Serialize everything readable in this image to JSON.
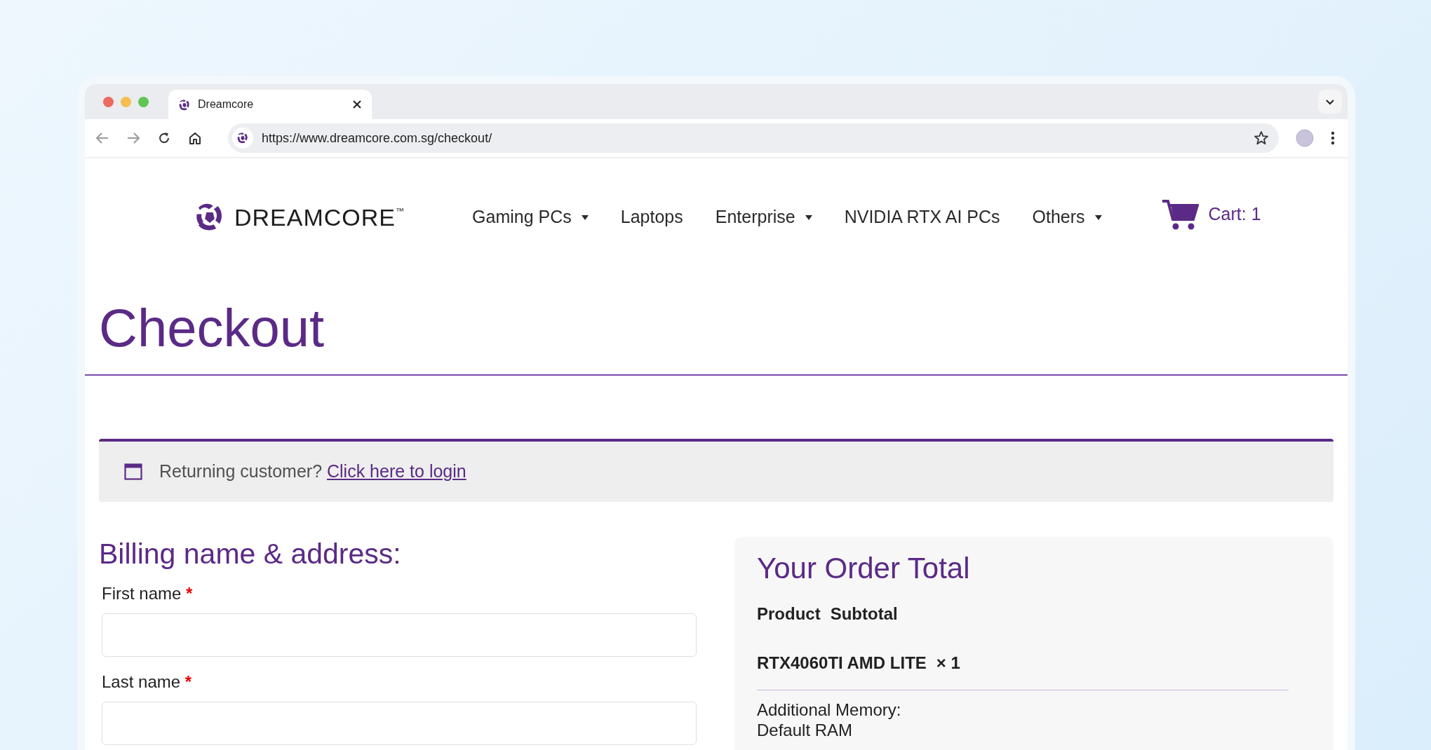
{
  "browser": {
    "tab_title": "Dreamcore",
    "url": "https://www.dreamcore.com.sg/checkout/"
  },
  "nav": {
    "logo_text": "DREAMCORE$^{™}$",
    "items": [
      {
        "label": "Gaming PCs",
        "dropdown": true
      },
      {
        "label": "Laptops",
        "dropdown": false
      },
      {
        "label": "Enterprise",
        "dropdown": true
      },
      {
        "label": "NVIDIA RTX AI PCs",
        "dropdown": false
      },
      {
        "label": "Others",
        "dropdown": true
      }
    ],
    "cart": "Cart: 1"
  },
  "page_title": "Checkout",
  "notice": {
    "text": "Returning customer?",
    "link": "Click here to login"
  },
  "billing": {
    "heading": "Billing name & address:",
    "fields": [
      {
        "label": "First name",
        "marker": "*"
      },
      {
        "label": "Last name",
        "marker": "*"
      }
    ]
  },
  "order": {
    "heading": "Your Order Total",
    "columns": [
      "Product",
      "Subtotal"
    ],
    "item": "RTX4060TI AMD LITE",
    "quantity": "× 1",
    "option_label": "Additional Memory:",
    "option_value": "Default RAM"
  }
}
